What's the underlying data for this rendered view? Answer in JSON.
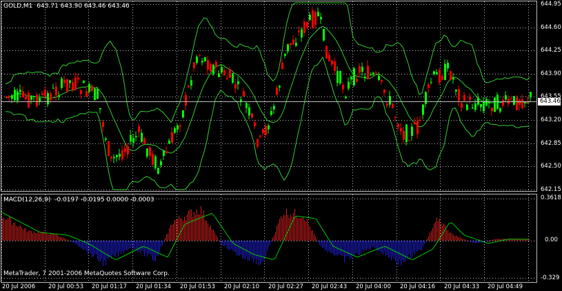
{
  "header": {
    "symbol": "GOLD,M1",
    "ohlc": "643.71 643.90 643.46 643.46"
  },
  "macd_header": {
    "name": "MACD(12,26,9)",
    "values": "-0.0197 -0.0195 0.0000 -0.0003"
  },
  "copyright": "MetaTrader, 7 2001-2006 MetaQuotes Software Corp.",
  "price_axis": [
    "644.95",
    "644.60",
    "644.25",
    "643.90",
    "643.55",
    "643.20",
    "642.85",
    "642.50",
    "642.15"
  ],
  "current_price": "643.46",
  "macd_axis": {
    "top": "0.3618",
    "zero": "0.00",
    "bottom": "-0.329"
  },
  "time_axis": [
    "20 Jul 2006",
    "20 Jul 00:53",
    "20 Jul 01:17",
    "20 Jul 01:34",
    "20 Jul 01:53",
    "20 Jul 02:10",
    "20 Jul 02:27",
    "20 Jul 02:43",
    "20 Jul 04:00",
    "20 Jul 04:16",
    "20 Jul 04:33",
    "20 Jul 04:49"
  ],
  "colors": {
    "bull": "#00ff00",
    "bear": "#ff0000",
    "grid": "#c0c0c0",
    "bands": "#32cd32",
    "macd_pos": "#d21e1e",
    "macd_neg": "#1e1ed2",
    "signal": "#00c800"
  },
  "chart_data": {
    "type": "candlestick",
    "price_range": [
      642.1,
      645.0
    ],
    "macd_range": [
      -0.329,
      0.3618
    ],
    "bands": "Bollinger Bands",
    "indicator": "MACD(12,26,9)"
  }
}
